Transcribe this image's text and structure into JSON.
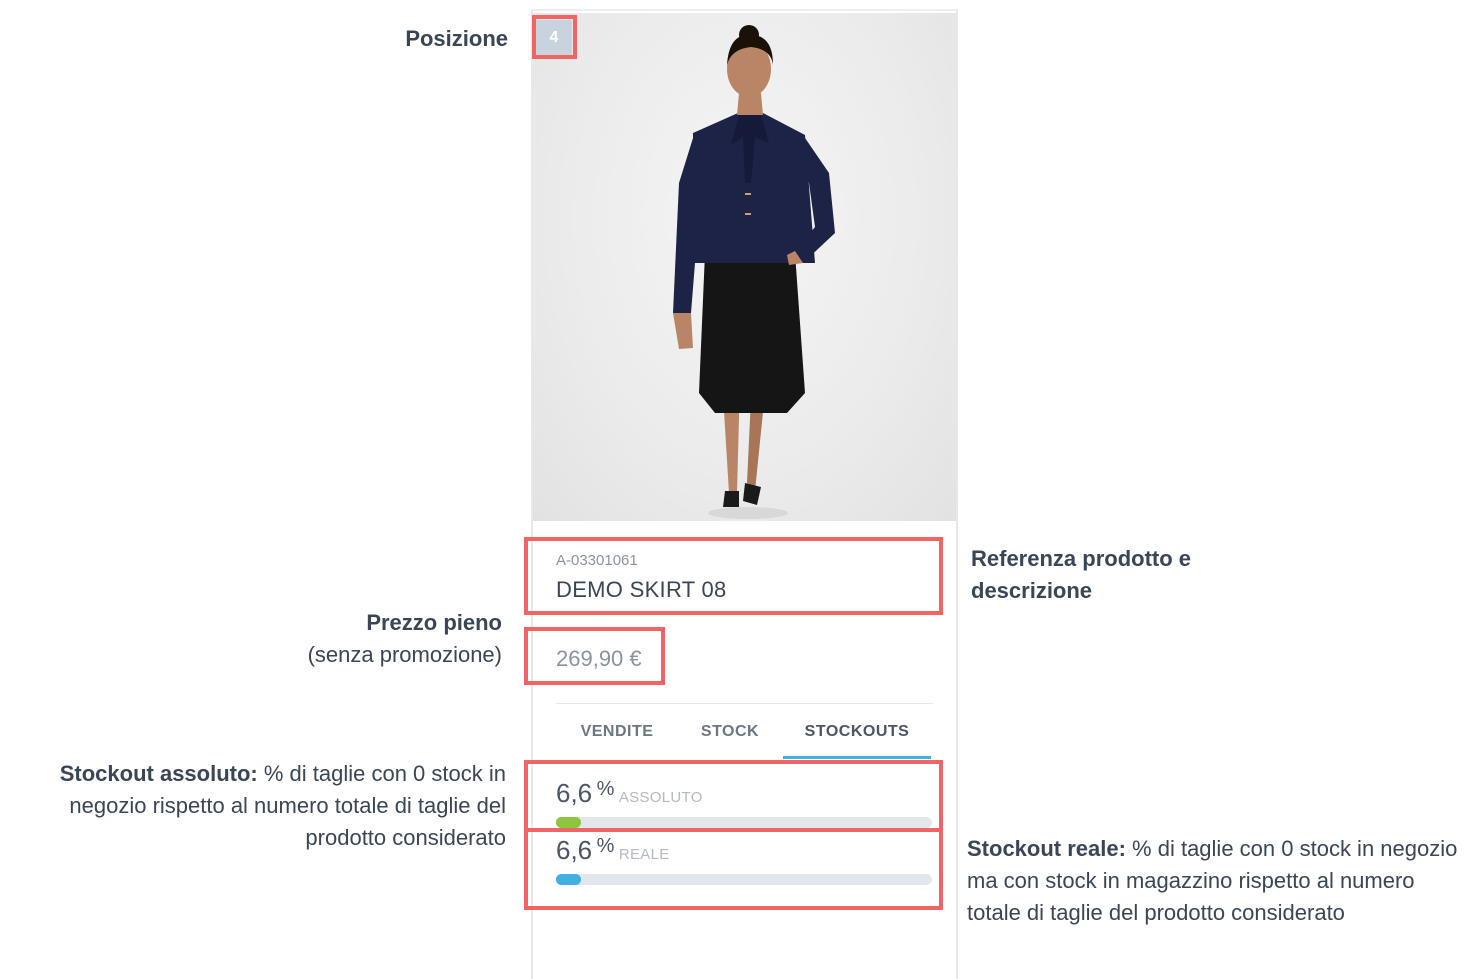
{
  "annotations": {
    "position": {
      "label": "Posizione"
    },
    "reference": {
      "label": "Referenza prodotto e descrizione"
    },
    "full_price": {
      "label": "Prezzo pieno",
      "sub": "(senza promozione)"
    },
    "stockout_absolute": {
      "bold": "Stockout assoluto:",
      "text": " % di taglie con 0 stock in negozio rispetto al numero totale di taglie del prodotto considerato"
    },
    "stockout_real": {
      "bold": "Stockout reale:",
      "text": " % di taglie con 0 stock in negozio ma con stock in magazzino rispetto al numero totale di taglie del prodotto considerato"
    }
  },
  "product": {
    "position": "4",
    "sku": "A-03301061",
    "name": "DEMO SKIRT 08",
    "price": "269,90 €",
    "image_icon": "product-photo-woman"
  },
  "tabs": [
    {
      "label": "VENDITE",
      "active": false
    },
    {
      "label": "STOCK",
      "active": false
    },
    {
      "label": "STOCKOUTS",
      "active": true
    }
  ],
  "stockouts": {
    "absolute": {
      "value": "6,6",
      "unit": "%",
      "label": "ASSOLUTO",
      "fraction": 0.066,
      "color": "#8cc63f"
    },
    "real": {
      "value": "6,6",
      "unit": "%",
      "label": "REALE",
      "fraction": 0.066,
      "color": "#3fb0e0"
    }
  },
  "colors": {
    "highlight": "#f06464",
    "tab_underline": "#3fb0e0",
    "text": "#3a4656"
  }
}
